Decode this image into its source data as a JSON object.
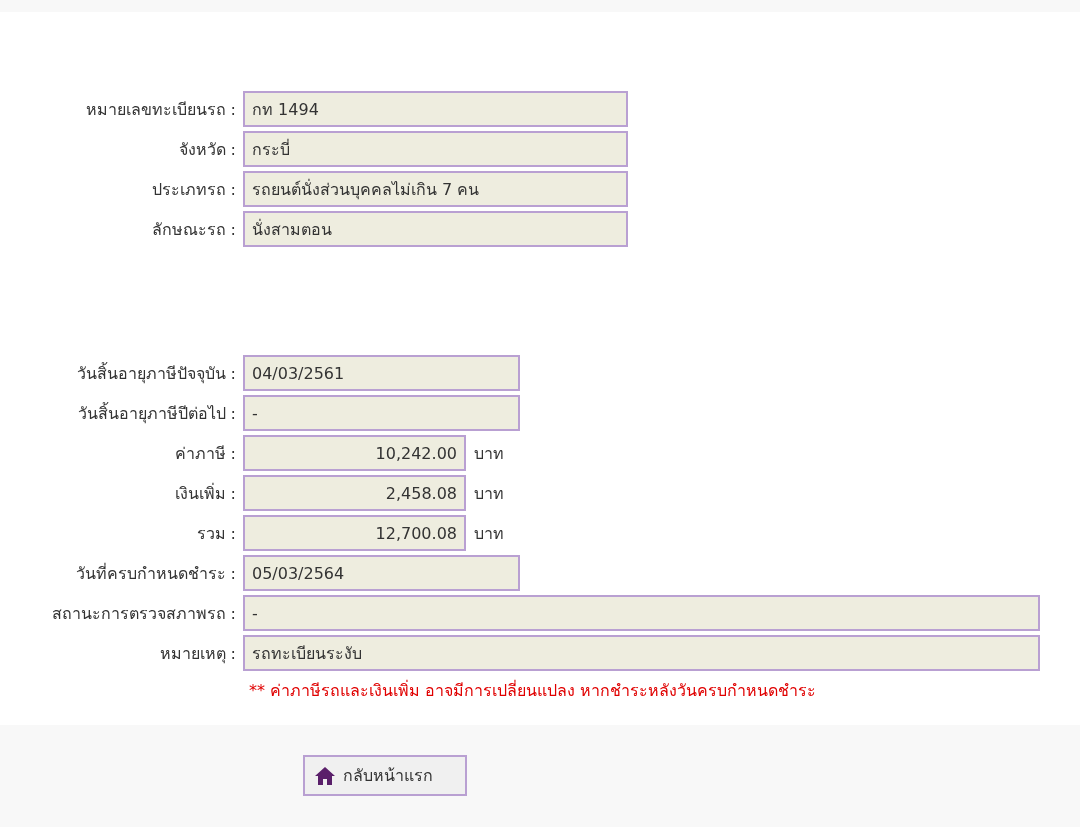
{
  "sections": [
    {
      "rows": [
        {
          "label": "หมายเลขทะเบียนรถ :",
          "value": "กท 1494",
          "kind": "standard"
        },
        {
          "label": "จังหวัด :",
          "value": "กระบี่",
          "kind": "standard"
        },
        {
          "label": "ประเภทรถ :",
          "value": "รถยนต์นั่งส่วนบุคคลไม่เกิน 7 คน",
          "kind": "standard"
        },
        {
          "label": "ลักษณะรถ :",
          "value": "นั่งสามตอน",
          "kind": "standard"
        }
      ]
    },
    {
      "rows": [
        {
          "label": "วันสิ้นอายุภาษีปัจจุบัน :",
          "value": "04/03/2561",
          "kind": "date"
        },
        {
          "label": "วันสิ้นอายุภาษีปีต่อไป :",
          "value": "-",
          "kind": "date"
        },
        {
          "label": "ค่าภาษี :",
          "value": "10,242.00",
          "kind": "amount",
          "unit": "บาท"
        },
        {
          "label": "เงินเพิ่ม :",
          "value": "2,458.08",
          "kind": "amount",
          "unit": "บาท"
        },
        {
          "label": "รวม :",
          "value": "12,700.08",
          "kind": "amount",
          "unit": "บาท"
        },
        {
          "label": "วันที่ครบกำหนดชำระ :",
          "value": "05/03/2564",
          "kind": "date"
        },
        {
          "label": "สถานะการตรวจสภาพรถ :",
          "value": "-",
          "kind": "wide"
        },
        {
          "label": "หมายเหตุ :",
          "value": "รถทะเบียนระงับ",
          "kind": "wide"
        }
      ]
    }
  ],
  "note": "** ค่าภาษีรถและเงินเพิ่ม อาจมีการเปลี่ยนแปลง หากชำระหลังวันครบกำหนดชำระ",
  "home_button": {
    "label": "กลับหน้าแรก"
  }
}
